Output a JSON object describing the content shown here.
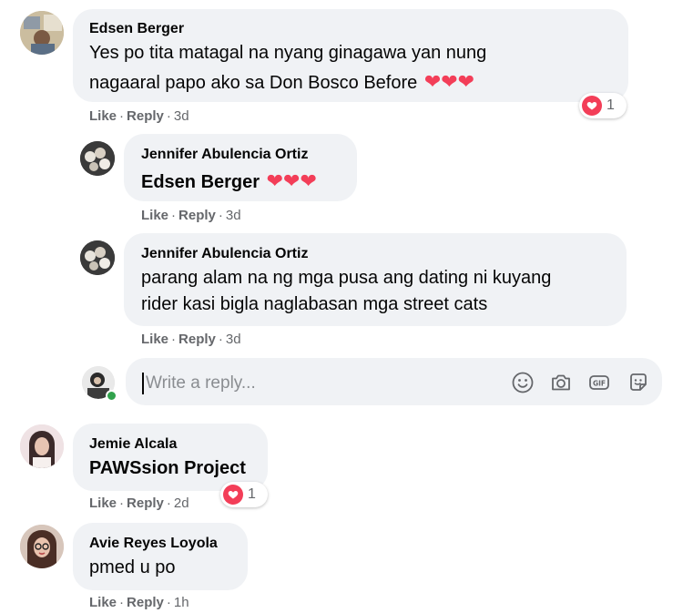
{
  "colors": {
    "bubble": "#f0f2f5",
    "meta_text": "#65676b",
    "heart": "#f33e58",
    "online": "#31a24c"
  },
  "comments": [
    {
      "author": "Edsen Berger",
      "lines": [
        "Yes po tita matagal na nyang ginagawa yan nung",
        "nagaaral papo ako sa Don Bosco Before"
      ],
      "emoji": "❤❤❤",
      "like": "Like",
      "reply": "Reply",
      "time": "3d",
      "reaction_count": "1"
    },
    {
      "author": "Jennifer Abulencia Ortiz",
      "lines": [
        "Edsen Berger"
      ],
      "emoji": "❤❤❤",
      "like": "Like",
      "reply": "Reply",
      "time": "3d"
    },
    {
      "author": "Jennifer Abulencia Ortiz",
      "lines": [
        "parang alam na ng mga pusa ang dating ni kuyang",
        "rider kasi bigla naglabasan mga street cats"
      ],
      "like": "Like",
      "reply": "Reply",
      "time": "3d"
    },
    {
      "author": "Jemie Alcala",
      "lines": [
        "PAWSsion Project"
      ],
      "like": "Like",
      "reply": "Reply",
      "time": "2d",
      "reaction_count": "1"
    },
    {
      "author": "Avie Reyes Loyola",
      "lines": [
        "pmed u po"
      ],
      "like": "Like",
      "reply": "Reply",
      "time": "1h"
    }
  ],
  "reply_input": {
    "placeholder": "Write a reply...",
    "icons": [
      "emoji-icon",
      "camera-icon",
      "gif-icon",
      "sticker-icon"
    ]
  }
}
